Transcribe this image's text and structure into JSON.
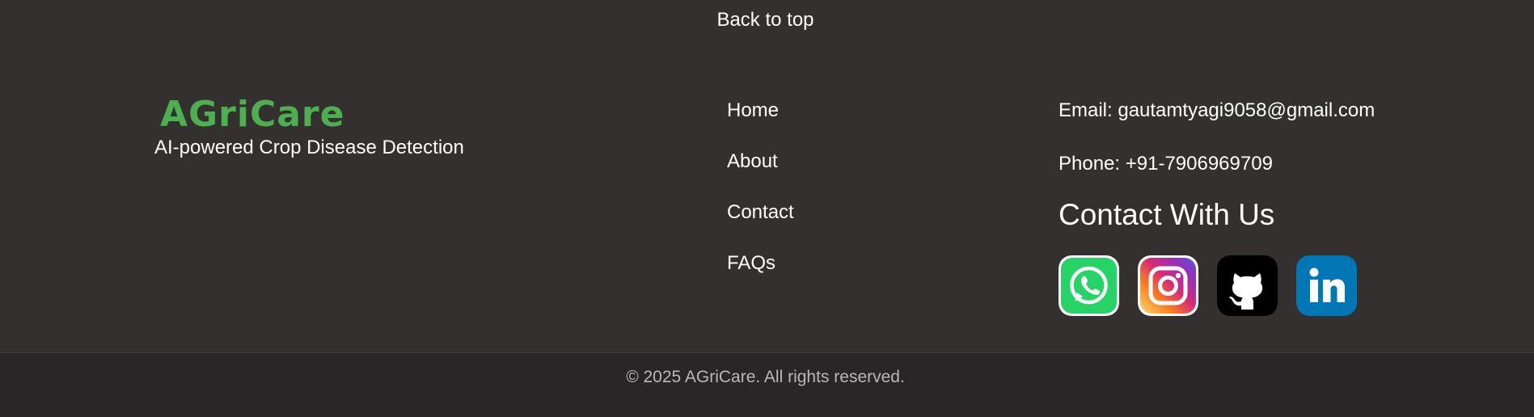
{
  "footer": {
    "back_to_top": "Back to top",
    "brand": {
      "name": "AGriCare",
      "tagline": "AI-powered Crop Disease Detection",
      "color": "#4caf50"
    },
    "nav": [
      {
        "label": "Home"
      },
      {
        "label": "About"
      },
      {
        "label": "Contact"
      },
      {
        "label": "FAQs"
      }
    ],
    "contact": {
      "email": "Email: gautamtyagi9058@gmail.com",
      "phone": "Phone: +91-7906969709",
      "heading": "Contact With Us"
    },
    "social": [
      {
        "name": "whatsapp-icon",
        "color": "#25d366"
      },
      {
        "name": "instagram-icon",
        "color": "#e1306c"
      },
      {
        "name": "github-icon",
        "color": "#000000"
      },
      {
        "name": "linkedin-icon",
        "color": "#0077b5"
      }
    ],
    "copyright": "© 2025 AGriCare. All rights reserved."
  },
  "colors": {
    "background": "#33302f",
    "bottom_bar": "#282627",
    "text": "#ffffff",
    "muted_text": "#b8b8b8"
  }
}
